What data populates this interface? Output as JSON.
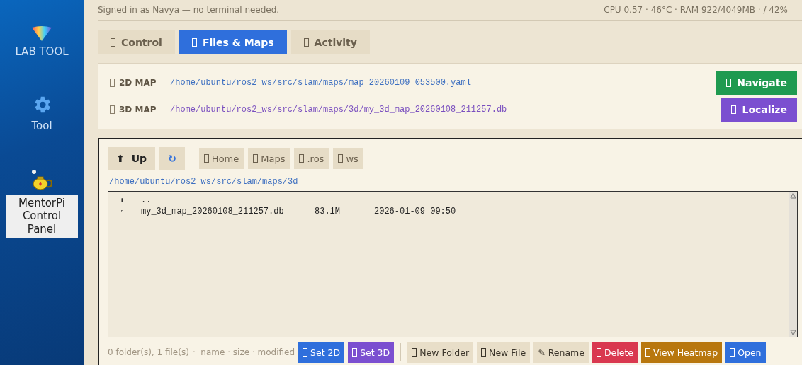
{
  "sidebar": {
    "items": [
      {
        "label": "LAB TOOL",
        "kind": "logo",
        "selected": false
      },
      {
        "label": "Tool",
        "kind": "gear",
        "selected": false
      },
      {
        "label": "MentorPi Control Panel",
        "kind": "teapot",
        "selected": true
      }
    ]
  },
  "header": {
    "signed_in": "Signed in as Navya — no terminal needed.",
    "stats": "CPU 0.57 · 46°C · RAM 922/4049MB · / 42%"
  },
  "tabs": [
    {
      "label": "Control",
      "selected": false
    },
    {
      "label": "Files & Maps",
      "selected": true
    },
    {
      "label": "Activity",
      "selected": false
    }
  ],
  "maps": [
    {
      "label": "2D MAP",
      "path": "/home/ubuntu/ros2_ws/src/slam/maps/map_20260109_053500.yaml",
      "color": "#3d6fc0",
      "action": {
        "label": "Navigate",
        "color": "#1f9a50"
      }
    },
    {
      "label": "3D MAP",
      "path": "/home/ubuntu/ros2_ws/src/slam/maps/3d/my_3d_map_20260108_211257.db",
      "color": "#7a4fbf",
      "action": {
        "label": "Localize",
        "color": "#7b4fd0"
      }
    }
  ],
  "browser": {
    "nav": [
      {
        "kind": "up",
        "glyph": "⬆",
        "label": "Up"
      },
      {
        "kind": "refresh",
        "glyph": "↻"
      }
    ],
    "bookmarks": [
      "Home",
      "Maps",
      ".ros",
      "ws"
    ],
    "current_path": "/home/ubuntu/ros2_ws/src/slam/maps/3d",
    "entries": [
      {
        "kind": "parent",
        "glyph": "⬆",
        "name": ".."
      },
      {
        "kind": "file",
        "glyph": "▫",
        "name": "my_3d_map_20260108_211257.db",
        "size": "83.1M",
        "modified": "2026-01-09 09:50"
      }
    ],
    "summary": "0 folder(s), 1 file(s)",
    "sort_hint": "·  name · size · modified",
    "actions": [
      {
        "label": "Set 2D",
        "kind": "filled",
        "color": "#2f6fdc"
      },
      {
        "label": "Set 3D",
        "kind": "filled",
        "color": "#7b4fd0"
      },
      {
        "label": "New Folder",
        "kind": "plain",
        "color": "#e8dec8"
      },
      {
        "label": "New File",
        "kind": "plain",
        "color": "#e8dec8"
      },
      {
        "label": "Rename",
        "kind": "plain",
        "color": "#e8dec8",
        "prefix": "✎"
      },
      {
        "label": "Delete",
        "kind": "filled",
        "color": "#d9384f"
      },
      {
        "label": "View Heatmap",
        "kind": "filled",
        "color": "#b8770e"
      },
      {
        "label": "Open",
        "kind": "filled",
        "color": "#2f6fdc"
      }
    ]
  }
}
